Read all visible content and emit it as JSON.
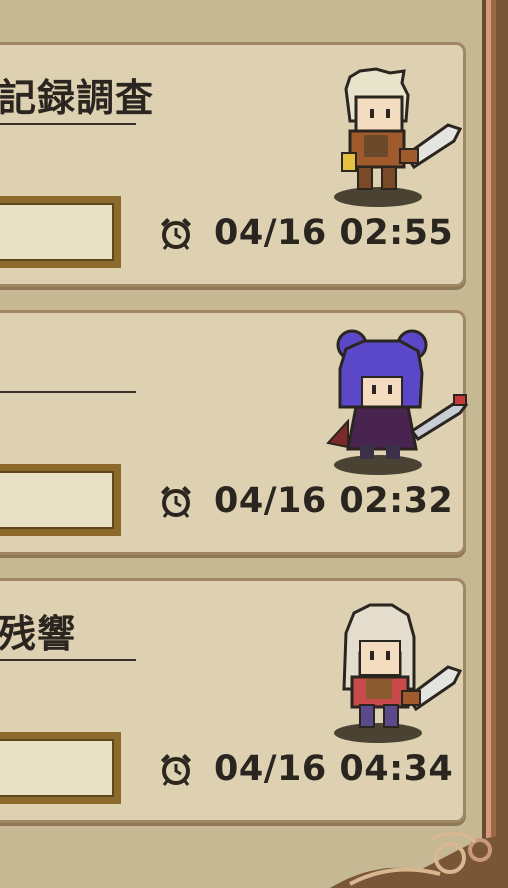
{
  "expeditions": [
    {
      "title": "記録調査",
      "timer": "04/16 02:55",
      "character": "blonde-swordsman"
    },
    {
      "title": "",
      "timer": "04/16 02:32",
      "character": "purple-haired-swordswoman"
    },
    {
      "title": "残響",
      "timer": "04/16 04:34",
      "character": "silver-haired-swordswoman"
    }
  ],
  "icons": {
    "timer": "alarm-clock-icon"
  },
  "colors": {
    "card": "#ddd1b2",
    "frame": "#8b6a2c",
    "text": "#2b2520"
  }
}
